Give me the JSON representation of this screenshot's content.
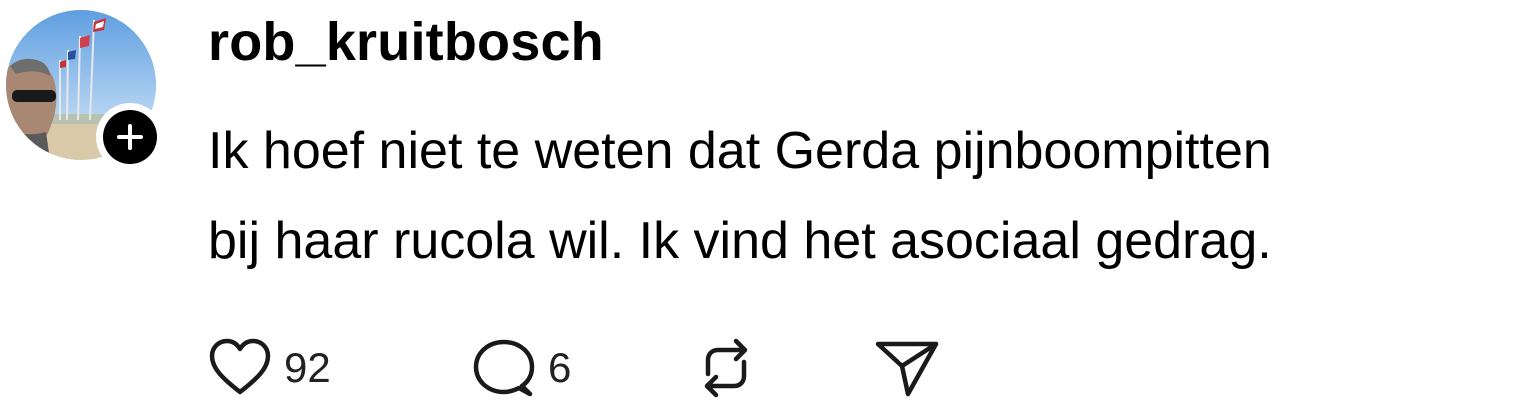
{
  "post": {
    "username": "rob_kruitbosch",
    "text_lines": [
      "Ik hoef niet te weten dat Gerda pijnboompitten",
      "bij haar rucola wil. Ik vind het asociaal gedrag."
    ]
  },
  "actions": {
    "like": {
      "icon": "heart-icon",
      "count": "92"
    },
    "reply": {
      "icon": "comment-bubble-icon",
      "count": "6"
    },
    "repost": {
      "icon": "repost-icon"
    },
    "share": {
      "icon": "send-icon"
    }
  },
  "avatar": {
    "icon": "user-avatar"
  },
  "follow": {
    "icon": "plus-icon"
  },
  "colors": {
    "text": "#000000",
    "muted": "#222222",
    "background": "#ffffff"
  }
}
